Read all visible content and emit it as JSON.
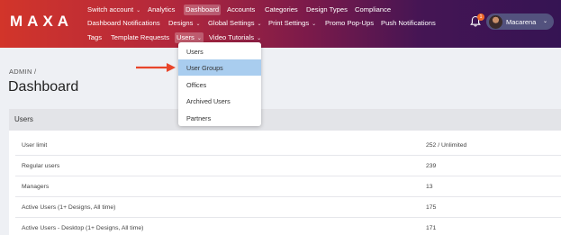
{
  "app": {
    "logo": "MAXA"
  },
  "nav": {
    "row1": [
      {
        "label": "Switch account",
        "chevron": true
      },
      {
        "label": "Analytics",
        "chevron": false
      },
      {
        "label": "Dashboard",
        "chevron": false,
        "active": true
      },
      {
        "label": "Accounts",
        "chevron": false
      },
      {
        "label": "Categories",
        "chevron": false
      },
      {
        "label": "Design Types",
        "chevron": false
      },
      {
        "label": "Compliance",
        "chevron": false
      }
    ],
    "row2": [
      {
        "label": "Dashboard Notifications",
        "chevron": false
      },
      {
        "label": "Designs",
        "chevron": true
      },
      {
        "label": "Global Settings",
        "chevron": true
      },
      {
        "label": "Print Settings",
        "chevron": true
      },
      {
        "label": "Promo Pop-Ups",
        "chevron": false
      },
      {
        "label": "Push Notifications",
        "chevron": false
      }
    ],
    "row3": [
      {
        "label": "Tags",
        "chevron": false
      },
      {
        "label": "Template Requests",
        "chevron": false
      },
      {
        "label": "Users",
        "chevron": true,
        "active": true
      },
      {
        "label": "Video Tutorials",
        "chevron": true
      }
    ],
    "chevron_glyph": "⌄"
  },
  "user": {
    "name": "Macarena",
    "notification_count": "1",
    "chevron": "⌄"
  },
  "breadcrumb": "ADMIN /",
  "page_title": "Dashboard",
  "users_dropdown": {
    "items": [
      "Users",
      "User Groups",
      "Offices",
      "Archived Users",
      "Partners"
    ],
    "selected_index": 1
  },
  "panel": {
    "title": "Users",
    "rows": [
      {
        "label": "User limit",
        "value": "252 / Unlimited"
      },
      {
        "label": "Regular users",
        "value": "239"
      },
      {
        "label": "Managers",
        "value": "13"
      },
      {
        "label": "Active Users (1+ Designs, All time)",
        "value": "175"
      },
      {
        "label": "Active Users - Desktop (1+ Designs, All time)",
        "value": "171"
      }
    ]
  },
  "colors": {
    "accent_arrow": "#e8452a",
    "dropdown_selected": "#a9cdef",
    "badge": "#f06a2a"
  }
}
